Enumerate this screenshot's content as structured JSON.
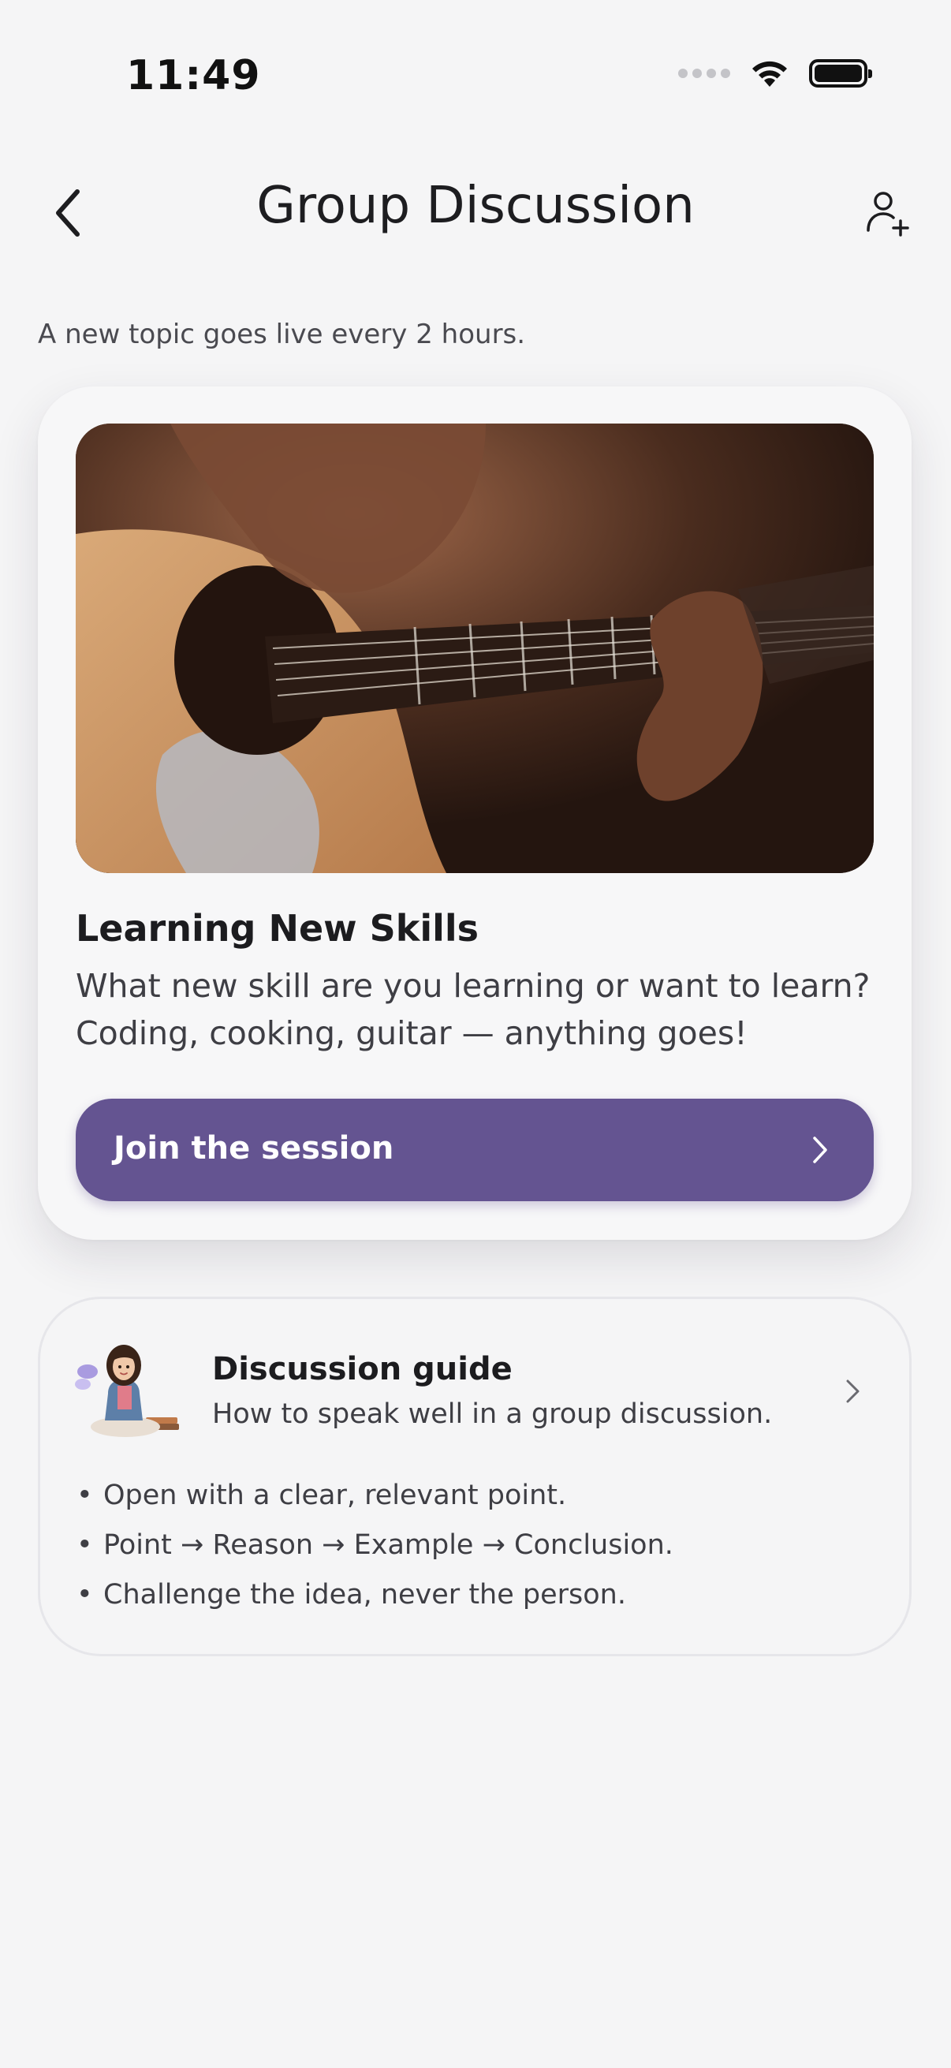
{
  "status_bar": {
    "time": "11:49"
  },
  "header": {
    "title": "Group Discussion",
    "back_icon": "chevron-left-icon",
    "action_icon": "person-add-icon"
  },
  "subtitle": "A new topic goes live every 2 hours.",
  "topic": {
    "image": "guitar-photo",
    "title": "Learning New Skills",
    "description": "What new skill are you learning or want to learn? Coding, cooking, guitar — anything goes!",
    "join_label": "Join the session",
    "accent_color": "#645491"
  },
  "guide": {
    "title": "Discussion guide",
    "subtitle": "How to speak well in a group discussion.",
    "points": [
      "Open with a clear, relevant point.",
      "Point → Reason → Example → Conclusion.",
      "Challenge the idea, never the person."
    ]
  }
}
